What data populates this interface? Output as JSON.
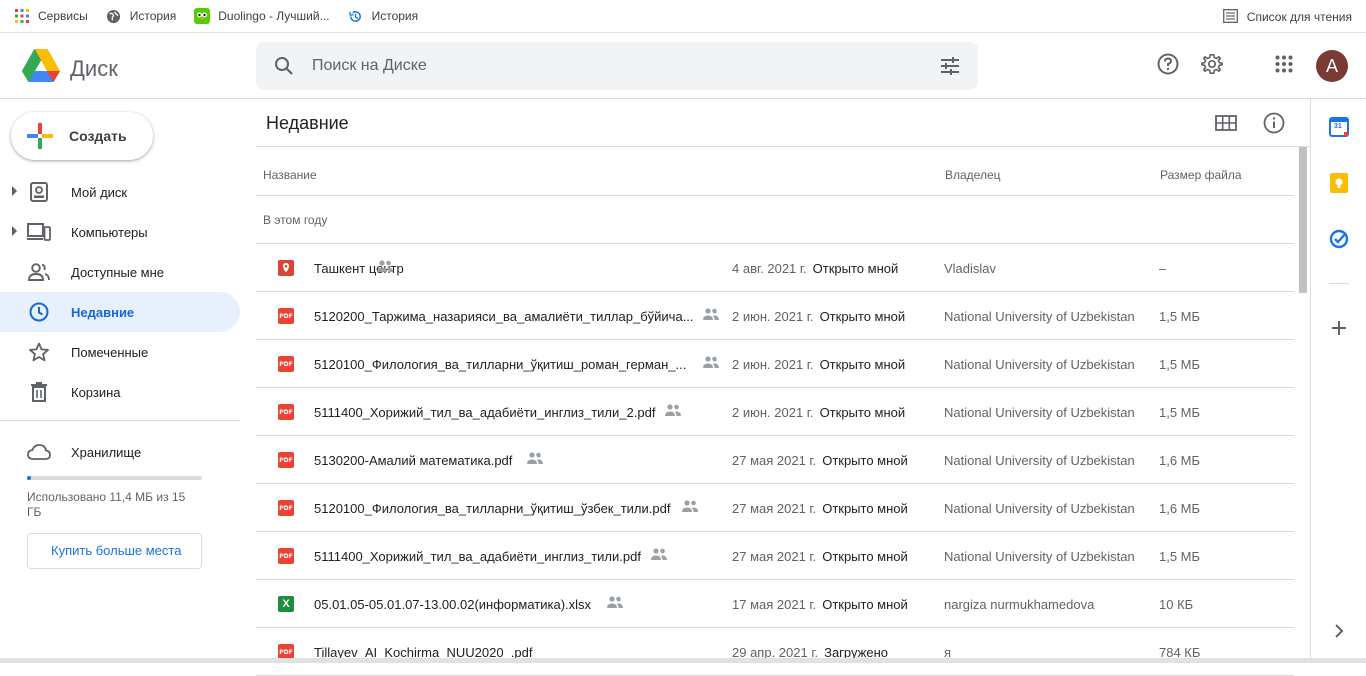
{
  "bookmarks": {
    "items": [
      {
        "label": "Сервисы",
        "icon": "apps-grid-icon"
      },
      {
        "label": "История",
        "icon": "globe-icon"
      },
      {
        "label": "Duolingo - Лучший...",
        "icon": "duolingo-owl-icon"
      },
      {
        "label": "История",
        "icon": "history-icon"
      }
    ],
    "reading_list": "Список для чтения"
  },
  "header": {
    "app_title": "Диск",
    "search_placeholder": "Поиск на Диске",
    "avatar_letter": "A"
  },
  "sidebar": {
    "create_label": "Создать",
    "items": [
      {
        "label": "Мой диск",
        "icon": "my-drive-icon",
        "expandable": true,
        "active": false
      },
      {
        "label": "Компьютеры",
        "icon": "computers-icon",
        "expandable": true,
        "active": false
      },
      {
        "label": "Доступные мне",
        "icon": "shared-people-icon",
        "expandable": false,
        "active": false
      },
      {
        "label": "Недавние",
        "icon": "clock-icon",
        "expandable": false,
        "active": true
      },
      {
        "label": "Помеченные",
        "icon": "star-icon",
        "expandable": false,
        "active": false
      },
      {
        "label": "Корзина",
        "icon": "trash-icon",
        "expandable": false,
        "active": false
      }
    ],
    "storage": {
      "label": "Хранилище",
      "used_text": "Использовано 11,4 МБ из 15 ГБ",
      "used_fraction": 0.01,
      "buy_label": "Купить больше места"
    }
  },
  "main": {
    "title": "Недавние",
    "columns": {
      "name": "Название",
      "owner": "Владелец",
      "size": "Размер файла"
    },
    "section": "В этом году",
    "rows": [
      {
        "name": "Ташкент центр",
        "type": "map",
        "date": "4 авг. 2021 г.",
        "action": "Открыто мной",
        "owner": "Vladislav",
        "size": "–"
      },
      {
        "name": "5120200_Таржима_назарияси_ва_амалиёти_тиллар_бўйича...",
        "type": "pdf",
        "date": "2 июн. 2021 г.",
        "action": "Открыто мной",
        "owner": "National University of Uzbekistan",
        "size": "1,5 МБ"
      },
      {
        "name": "5120100_Филология_ва_тилларни_ўқитиш_роман_герман_...",
        "type": "pdf",
        "date": "2 июн. 2021 г.",
        "action": "Открыто мной",
        "owner": "National University of Uzbekistan",
        "size": "1,5 МБ"
      },
      {
        "name": "5111400_Хорижий_тил_ва_адабиёти_инглиз_тили_2.pdf",
        "type": "pdf",
        "date": "2 июн. 2021 г.",
        "action": "Открыто мной",
        "owner": "National University of Uzbekistan",
        "size": "1,5 МБ"
      },
      {
        "name": "5130200-Амалий математика.pdf",
        "type": "pdf",
        "date": "27 мая 2021 г.",
        "action": "Открыто мной",
        "owner": "National University of Uzbekistan",
        "size": "1,6 МБ"
      },
      {
        "name": "5120100_Филология_ва_тилларни_ўқитиш_ўзбек_тили.pdf",
        "type": "pdf",
        "date": "27 мая 2021 г.",
        "action": "Открыто мной",
        "owner": "National University of Uzbekistan",
        "size": "1,6 МБ"
      },
      {
        "name": "5111400_Хорижий_тил_ва_адабиёти_инглиз_тили.pdf",
        "type": "pdf",
        "date": "27 мая 2021 г.",
        "action": "Открыто мной",
        "owner": "National University of Uzbekistan",
        "size": "1,5 МБ"
      },
      {
        "name": "05.01.05-05.01.07-13.00.02(информатика).xlsx",
        "type": "xlsx",
        "date": "17 мая 2021 г.",
        "action": "Открыто мной",
        "owner": "nargiza nurmukhamedova",
        "size": "10 КБ"
      },
      {
        "name": "Tillayev_AI_Kochirma_NUU2020_.pdf",
        "type": "pdf",
        "date": "29 апр. 2021 г.",
        "action": "Загружено",
        "owner": "я",
        "size": "784 КБ"
      }
    ]
  },
  "right_panel": {
    "calendar_day": "31"
  },
  "colors": {
    "accent": "#1a73e8",
    "active_bg": "#e8f0fe",
    "pdf": "#ea4335",
    "xlsx": "#1e8e3e"
  }
}
